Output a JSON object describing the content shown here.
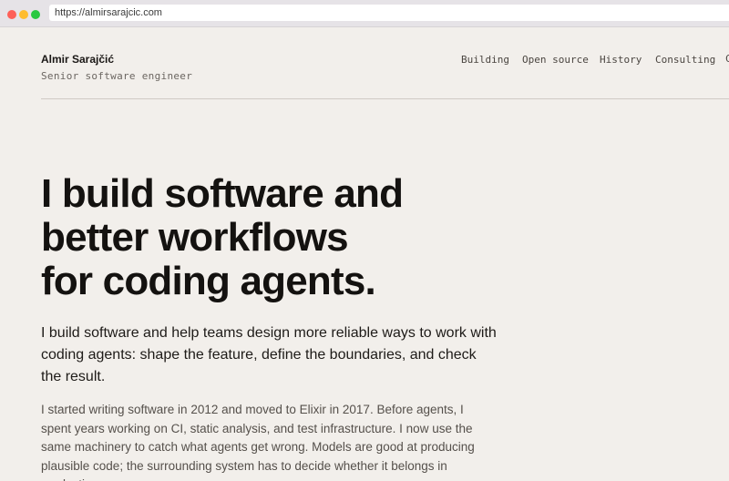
{
  "browser": {
    "url": "https://almirsarajcic.com"
  },
  "header": {
    "name": "Almir Sarajčić",
    "tagline": "Senior software engineer",
    "nav": {
      "building": "Building",
      "open_source": "Open source",
      "history": "History",
      "consulting": "Consulting",
      "more": "C"
    }
  },
  "hero": {
    "headline_lines": [
      "I build software and",
      "better workflows",
      "for coding agents."
    ],
    "lede": "I build software and help teams design more reliable ways to work with coding agents: shape the feature, define the boundaries, and check the result.",
    "body": "I started writing software in 2012 and moved to Elixir in 2017. Before agents, I spent years working on CI, static analysis, and test infrastructure. I now use the same machinery to catch what agents get wrong. Models are good at producing plausible code; the surrounding system has to decide whether it belongs in production."
  }
}
